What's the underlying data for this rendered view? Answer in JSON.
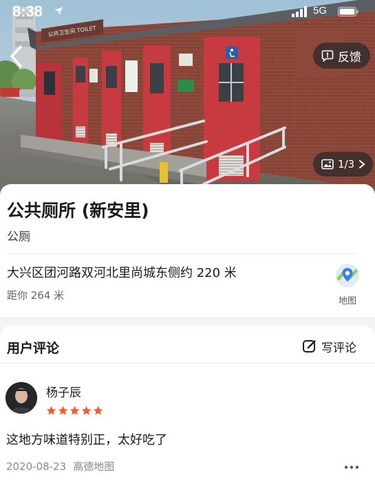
{
  "status_bar": {
    "time": "8:38",
    "network": "5G"
  },
  "hero": {
    "feedback_label": "反馈",
    "photo_counter": "1/3",
    "sign_text": "公共卫生间 TOILET"
  },
  "place": {
    "name": "公共厕所 (新安里)",
    "category": "公厕",
    "address": "大兴区团河路双河北里尚城东侧约 220 米",
    "distance": "距你 264 米",
    "map_label": "地图"
  },
  "reviews": {
    "section_title": "用户评论",
    "write_label": "写评论",
    "items": [
      {
        "user": "杨子辰",
        "rating": 5,
        "text": "这地方味道特别正，太好吃了",
        "date": "2020-08-23",
        "source": "高德地图"
      }
    ]
  },
  "colors": {
    "star": "#ff5a2c",
    "door_red": "#c73a3f",
    "wall_brick": "#8d4a3c"
  }
}
